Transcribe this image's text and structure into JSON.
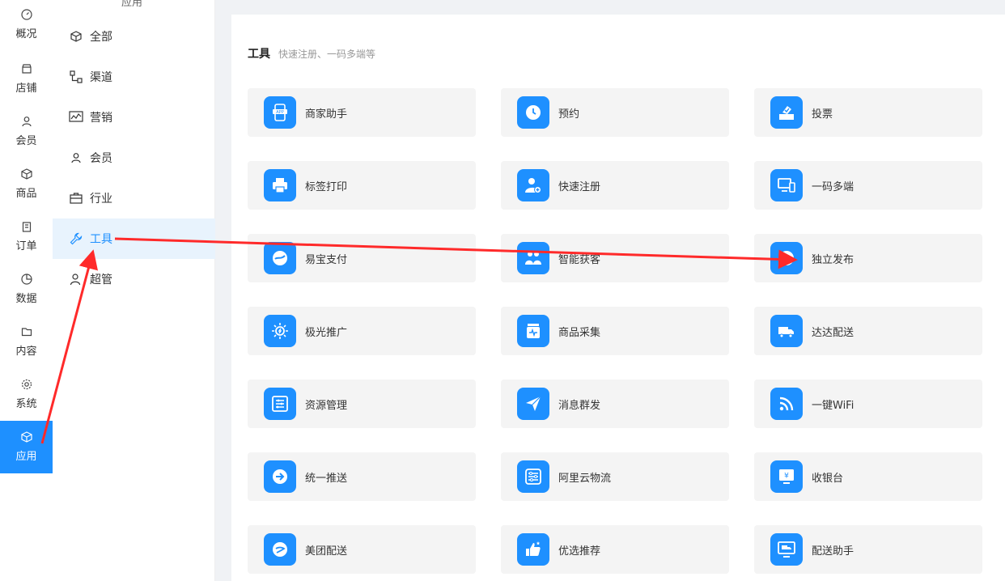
{
  "rail": {
    "items": [
      {
        "label": "概况",
        "icon": "dashboard-icon"
      },
      {
        "label": "店铺",
        "icon": "store-icon"
      },
      {
        "label": "会员",
        "icon": "user-icon"
      },
      {
        "label": "商品",
        "icon": "box-icon"
      },
      {
        "label": "订单",
        "icon": "clipboard-icon"
      },
      {
        "label": "数据",
        "icon": "pie-icon"
      },
      {
        "label": "内容",
        "icon": "folder-icon"
      },
      {
        "label": "系统",
        "icon": "gear-icon"
      },
      {
        "label": "应用",
        "icon": "cube-icon",
        "active": true
      }
    ]
  },
  "submenu": {
    "title": "应用",
    "items": [
      {
        "label": "全部",
        "icon": "cube-icon"
      },
      {
        "label": "渠道",
        "icon": "channel-icon"
      },
      {
        "label": "营销",
        "icon": "marketing-icon"
      },
      {
        "label": "会员",
        "icon": "user-icon"
      },
      {
        "label": "行业",
        "icon": "briefcase-icon"
      },
      {
        "label": "工具",
        "icon": "wrench-icon",
        "active": true
      },
      {
        "label": "超管",
        "icon": "admin-icon"
      }
    ]
  },
  "section": {
    "title": "工具",
    "subtitle": "快速注册、一码多端等"
  },
  "cards": [
    {
      "label": "商家助手",
      "icon": "app-phone-icon"
    },
    {
      "label": "预约",
      "icon": "clock-icon"
    },
    {
      "label": "投票",
      "icon": "ballot-icon"
    },
    {
      "label": "标签打印",
      "icon": "printer-icon"
    },
    {
      "label": "快速注册",
      "icon": "add-user-icon"
    },
    {
      "label": "一码多端",
      "icon": "devices-icon"
    },
    {
      "label": "易宝支付",
      "icon": "pay-icon"
    },
    {
      "label": "智能获客",
      "icon": "people-icon"
    },
    {
      "label": "独立发布",
      "icon": "upload-icon"
    },
    {
      "label": "极光推广",
      "icon": "sun-icon"
    },
    {
      "label": "商品采集",
      "icon": "collect-icon"
    },
    {
      "label": "达达配送",
      "icon": "truck-icon"
    },
    {
      "label": "资源管理",
      "icon": "sliders-icon"
    },
    {
      "label": "消息群发",
      "icon": "send-icon"
    },
    {
      "label": "一键WiFi",
      "icon": "wifi-icon"
    },
    {
      "label": "统一推送",
      "icon": "arrow-circle-icon"
    },
    {
      "label": "阿里云物流",
      "icon": "logistics-icon"
    },
    {
      "label": "收银台",
      "icon": "cashier-icon"
    },
    {
      "label": "美团配送",
      "icon": "delivery-icon"
    },
    {
      "label": "优选推荐",
      "icon": "thumbs-up-icon"
    },
    {
      "label": "配送助手",
      "icon": "delivery-monitor-icon"
    }
  ],
  "colors": {
    "accent": "#1e90ff",
    "arrow": "#ff2a2a"
  }
}
